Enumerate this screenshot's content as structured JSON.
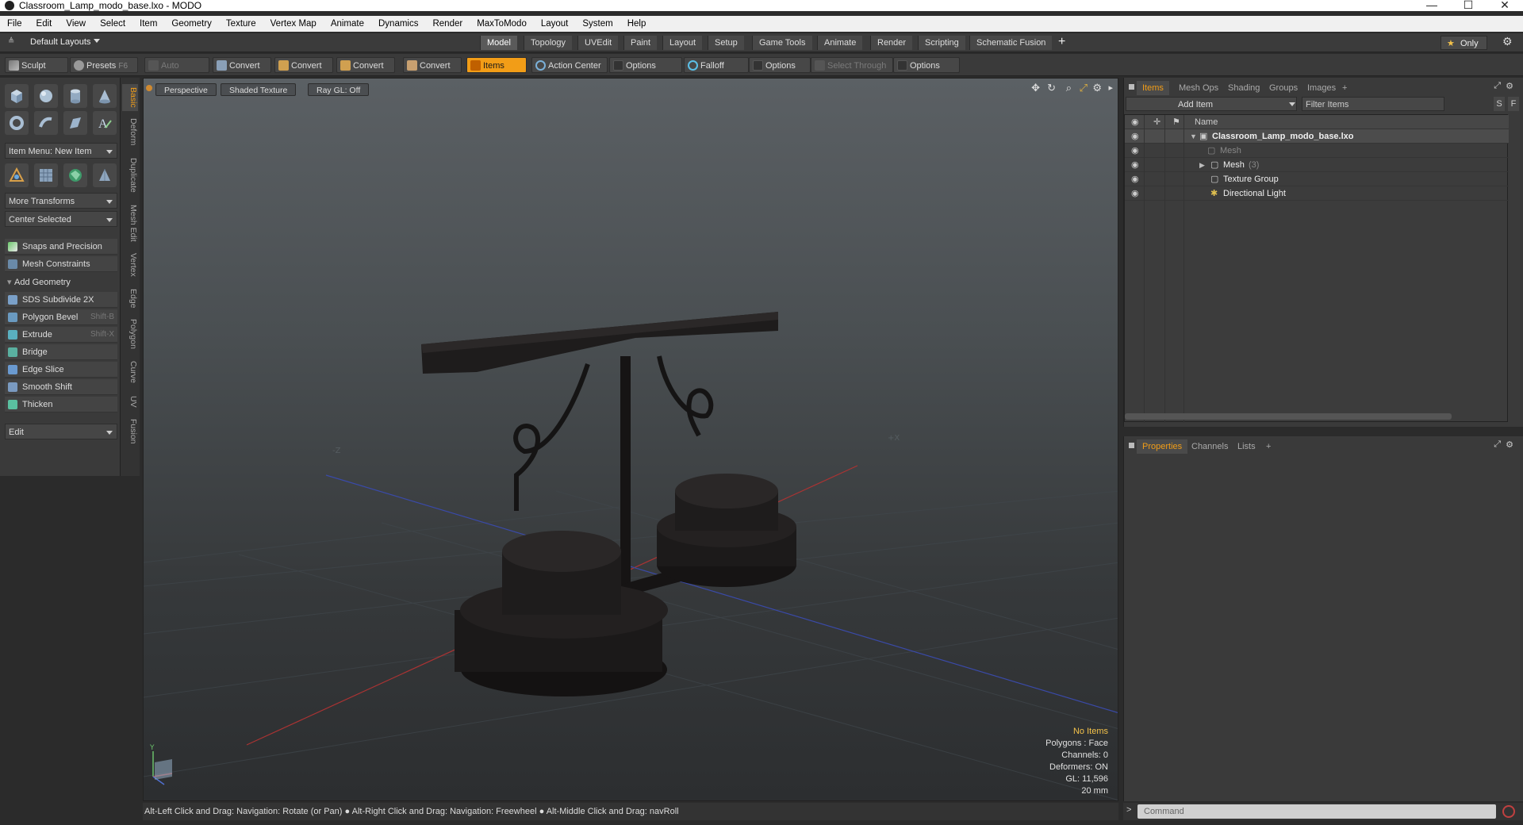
{
  "window": {
    "title": "Classroom_Lamp_modo_base.lxo - MODO",
    "minimize": "—",
    "maximize": "☐",
    "close": "✕"
  },
  "menu": [
    "File",
    "Edit",
    "View",
    "Select",
    "Item",
    "Geometry",
    "Texture",
    "Vertex Map",
    "Animate",
    "Dynamics",
    "Render",
    "MaxToModo",
    "Layout",
    "System",
    "Help"
  ],
  "layoutbar": {
    "layouts_label": "Default Layouts",
    "tabs": [
      "Model",
      "Topology",
      "UVEdit",
      "Paint",
      "Layout",
      "Setup",
      "Game Tools",
      "Animate",
      "Render",
      "Scripting",
      "Schematic Fusion"
    ],
    "active_tab": "Model",
    "add": "+",
    "only": "Only"
  },
  "toolbar": {
    "sculpt": "Sculpt",
    "presets": "Presets",
    "presets_key": "F6",
    "auto_select": "Auto Select",
    "convert1": "Convert",
    "convert2": "Convert",
    "convert3": "Convert",
    "convert4": "Convert",
    "items": "Items",
    "action_center": "Action Center",
    "options1": "Options",
    "falloff": "Falloff",
    "options2": "Options",
    "select_through": "Select Through",
    "options3": "Options"
  },
  "left": {
    "item_menu": "Item Menu: New Item",
    "more_transforms": "More Transforms",
    "center_selected": "Center Selected",
    "snaps": "Snaps and Precision",
    "mesh_constraints": "Mesh Constraints",
    "add_geometry": "Add Geometry",
    "tools": [
      {
        "label": "SDS Subdivide 2X",
        "shortcut": ""
      },
      {
        "label": "Polygon Bevel",
        "shortcut": "Shift-B"
      },
      {
        "label": "Extrude",
        "shortcut": "Shift-X"
      },
      {
        "label": "Bridge",
        "shortcut": ""
      },
      {
        "label": "Edge Slice",
        "shortcut": ""
      },
      {
        "label": "Smooth Shift",
        "shortcut": ""
      },
      {
        "label": "Thicken",
        "shortcut": ""
      }
    ],
    "edit": "Edit",
    "vtabs": [
      "Basic",
      "Deform",
      "Duplicate",
      "Mesh Edit",
      "Vertex",
      "Edge",
      "Polygon",
      "Curve",
      "UV",
      "Fusion"
    ]
  },
  "viewport": {
    "perspective": "Perspective",
    "shading": "Shaded Texture",
    "raygl": "Ray GL: Off",
    "axis_neg_z": "-Z",
    "axis_pos_x": "+X",
    "gizmo_y": "Y",
    "stats": {
      "no_items": "No Items",
      "polygons": "Polygons : Face",
      "channels": "Channels: 0",
      "deformers": "Deformers: ON",
      "gl": "GL: 11,596",
      "size": "20 mm"
    }
  },
  "status": {
    "hint1": "Alt-Left Click and Drag: Navigation: Rotate (or Pan)",
    "hint2": "Alt-Right Click and Drag: Navigation: Freewheel",
    "hint3": "Alt-Middle Click and Drag: navRoll"
  },
  "items_panel": {
    "tabs": [
      "Items",
      "Mesh Ops",
      "Shading",
      "Groups",
      "Images"
    ],
    "add": "+",
    "add_item": "Add Item",
    "filter": "Filter Items",
    "s_btn": "S",
    "f_btn": "F",
    "col_name": "Name",
    "rows": [
      {
        "name": "Classroom_Lamp_modo_base.lxo",
        "extra": ""
      },
      {
        "name": "Mesh",
        "extra": ""
      },
      {
        "name": "Mesh",
        "extra": "(3)"
      },
      {
        "name": "Texture Group",
        "extra": ""
      },
      {
        "name": "Directional Light",
        "extra": ""
      }
    ]
  },
  "props_panel": {
    "tabs": [
      "Properties",
      "Channels",
      "Lists"
    ],
    "add": "+"
  },
  "command": {
    "placeholder": "Command"
  },
  "colors": {
    "accent": "#f29d17"
  }
}
